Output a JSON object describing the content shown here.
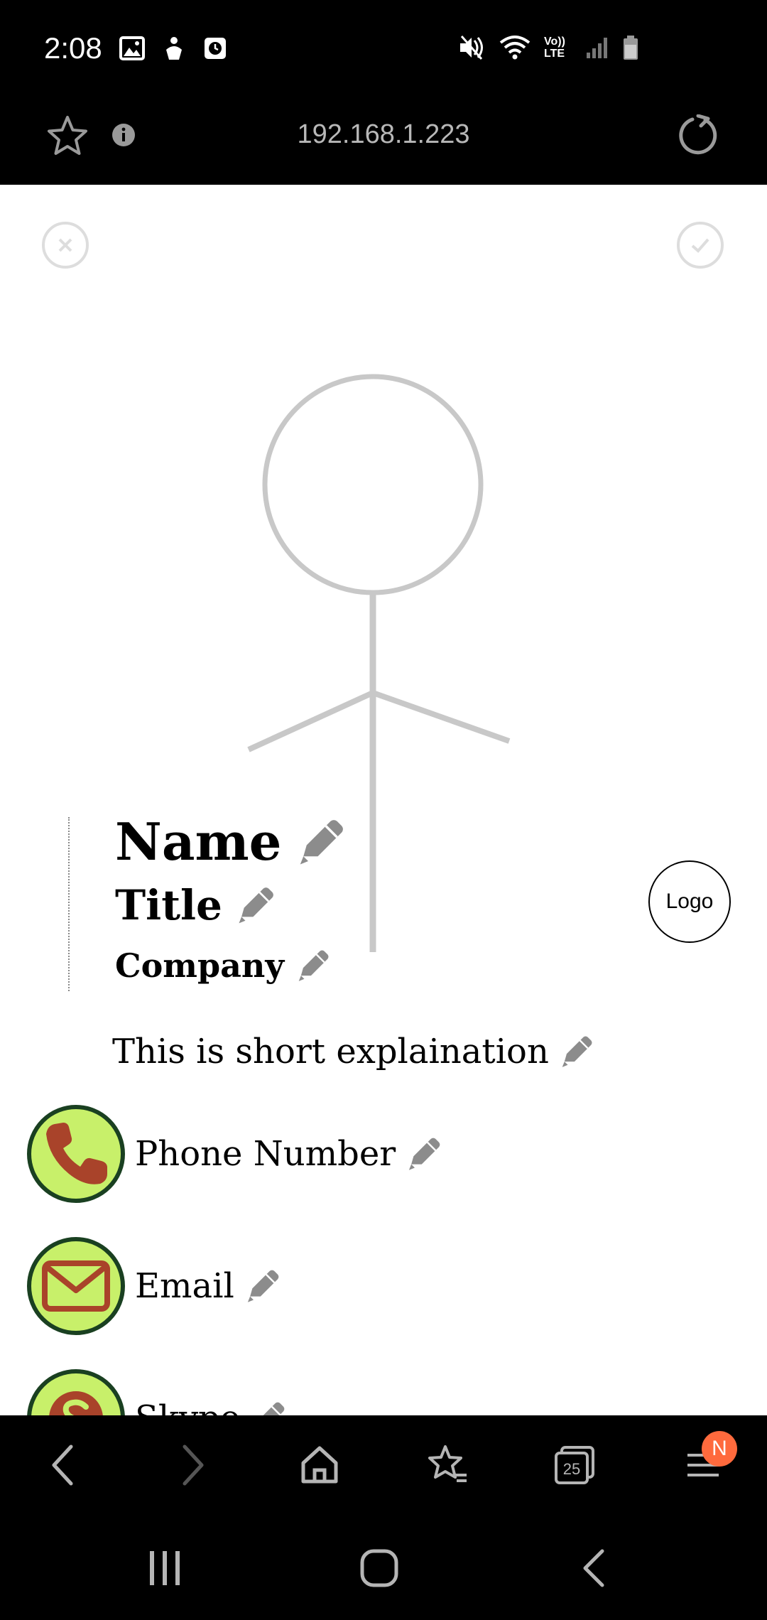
{
  "status_bar": {
    "time": "2:08",
    "left_icons": [
      "image-icon",
      "figure-icon",
      "clock-app-icon"
    ],
    "right_icons": [
      "mute-icon",
      "wifi-icon",
      "volte-icon",
      "signal-icon",
      "battery-icon"
    ],
    "volte_text": "Vo)) LTE"
  },
  "toolbar": {
    "url": "192.168.1.223"
  },
  "profile": {
    "name": "Name",
    "title": "Title",
    "company": "Company",
    "logo": "Logo",
    "explanation": "This is short explaination"
  },
  "contacts": [
    {
      "label": "Phone Number",
      "icon": "phone-icon"
    },
    {
      "label": "Email",
      "icon": "email-icon"
    },
    {
      "label": "Skype",
      "icon": "skype-icon"
    }
  ],
  "bottom_nav": {
    "tabs_count": "25",
    "menu_badge": "N"
  },
  "colors": {
    "contact_fill": "#c8f06a",
    "contact_ring": "#1a4021",
    "contact_icon": "#a9432a",
    "pencil": "#8c8c8c",
    "badge": "#ff6a3d"
  }
}
